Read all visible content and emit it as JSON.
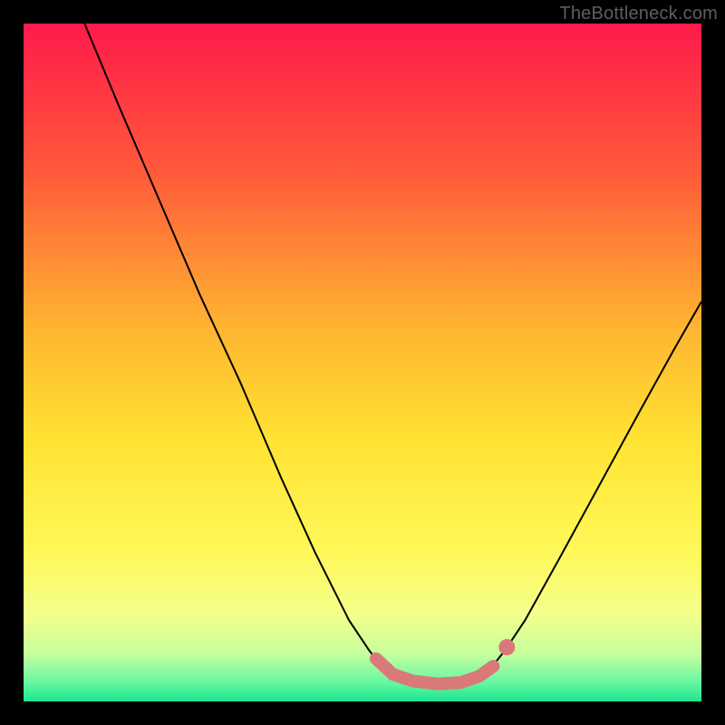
{
  "watermark": "TheBottleneck.com",
  "chart_data": {
    "type": "line",
    "title": "",
    "xlabel": "",
    "ylabel": "",
    "xlim": [
      0,
      1
    ],
    "ylim": [
      0,
      1
    ],
    "grid": false,
    "gradient_stops": [
      {
        "offset": 0.0,
        "color": "#ff1a4b"
      },
      {
        "offset": 0.22,
        "color": "#ff5a3a"
      },
      {
        "offset": 0.45,
        "color": "#ffb531"
      },
      {
        "offset": 0.62,
        "color": "#ffe433"
      },
      {
        "offset": 0.78,
        "color": "#fff85a"
      },
      {
        "offset": 0.87,
        "color": "#f4ff8a"
      },
      {
        "offset": 0.93,
        "color": "#c6ff9e"
      },
      {
        "offset": 0.97,
        "color": "#6cf7a2"
      },
      {
        "offset": 1.0,
        "color": "#1de58f"
      }
    ],
    "series": [
      {
        "name": "curve",
        "stroke": "#000000",
        "stroke_width": 2,
        "points": [
          {
            "x": 0.09,
            "y": 1.0
          },
          {
            "x": 0.14,
            "y": 0.88
          },
          {
            "x": 0.2,
            "y": 0.74
          },
          {
            "x": 0.26,
            "y": 0.6
          },
          {
            "x": 0.32,
            "y": 0.47
          },
          {
            "x": 0.38,
            "y": 0.33
          },
          {
            "x": 0.43,
            "y": 0.22
          },
          {
            "x": 0.48,
            "y": 0.12
          },
          {
            "x": 0.51,
            "y": 0.075
          },
          {
            "x": 0.53,
            "y": 0.05
          },
          {
            "x": 0.555,
            "y": 0.035
          },
          {
            "x": 0.59,
            "y": 0.028
          },
          {
            "x": 0.63,
            "y": 0.028
          },
          {
            "x": 0.665,
            "y": 0.035
          },
          {
            "x": 0.69,
            "y": 0.05
          },
          {
            "x": 0.71,
            "y": 0.075
          },
          {
            "x": 0.74,
            "y": 0.12
          },
          {
            "x": 0.79,
            "y": 0.21
          },
          {
            "x": 0.85,
            "y": 0.32
          },
          {
            "x": 0.91,
            "y": 0.43
          },
          {
            "x": 0.96,
            "y": 0.52
          },
          {
            "x": 1.0,
            "y": 0.59
          }
        ]
      },
      {
        "name": "valley-highlight",
        "stroke": "#d97a78",
        "stroke_width": 14,
        "linecap": "round",
        "points": [
          {
            "x": 0.52,
            "y": 0.063
          },
          {
            "x": 0.545,
            "y": 0.04
          },
          {
            "x": 0.575,
            "y": 0.03
          },
          {
            "x": 0.61,
            "y": 0.026
          },
          {
            "x": 0.645,
            "y": 0.028
          },
          {
            "x": 0.672,
            "y": 0.037
          },
          {
            "x": 0.693,
            "y": 0.052
          }
        ]
      },
      {
        "name": "highlight-end-dot",
        "type": "dot",
        "fill": "#d97a78",
        "r": 9,
        "point": {
          "x": 0.713,
          "y": 0.08
        }
      }
    ]
  }
}
